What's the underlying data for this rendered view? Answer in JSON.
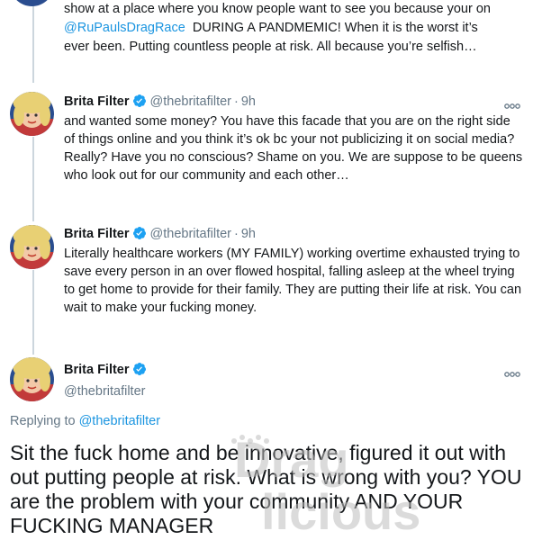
{
  "tweet0": {
    "line1": "show at a place where you know people want to see you because your on",
    "mention": "@RuPaulsDragRace",
    "line2_rest": "  DURING A PANDMEMIC! When it is the worst it’s",
    "line3": "ever been. Putting countless people at risk. All because you’re selfish…"
  },
  "tweet1": {
    "name": "Brita Filter",
    "handle": "@thebritafilter",
    "separator": "·",
    "time": "9h",
    "text": "and wanted some money? You have this facade that you are on the right side of things online and you think it’s ok bc your not publicizing it on social media? Really? Have you no conscious? Shame on you. We are suppose to be queens who look out for our community and each other…"
  },
  "tweet2": {
    "name": "Brita Filter",
    "handle": "@thebritafilter",
    "separator": "·",
    "time": "9h",
    "text": "Literally healthcare workers (MY FAMILY) working overtime exhausted trying to save every person in an over flowed hospital, falling asleep at the wheel trying to get home to provide for their family. They are putting their life at risk. You can wait to make your fucking money."
  },
  "tweet3": {
    "name": "Brita Filter",
    "handle": "@thebritafilter",
    "replying_prefix": "Replying to ",
    "replying_handle": "@thebritafilter",
    "text": "Sit the fuck home and be innovative, figured it out with out putting people at risk. What is wrong with you? YOU are the problem with your community AND YOUR FUCKING MANAGER"
  },
  "watermark": {
    "line1": "Drag",
    "line2": "licious"
  },
  "icons": {
    "verified": "verified-badge-icon",
    "more": "more-options-icon",
    "avatar": "avatar"
  },
  "colors": {
    "link": "#1b95e0",
    "secondary_text": "#657786",
    "thread_line": "#ccd6dd",
    "verified": "#1da1f2"
  }
}
